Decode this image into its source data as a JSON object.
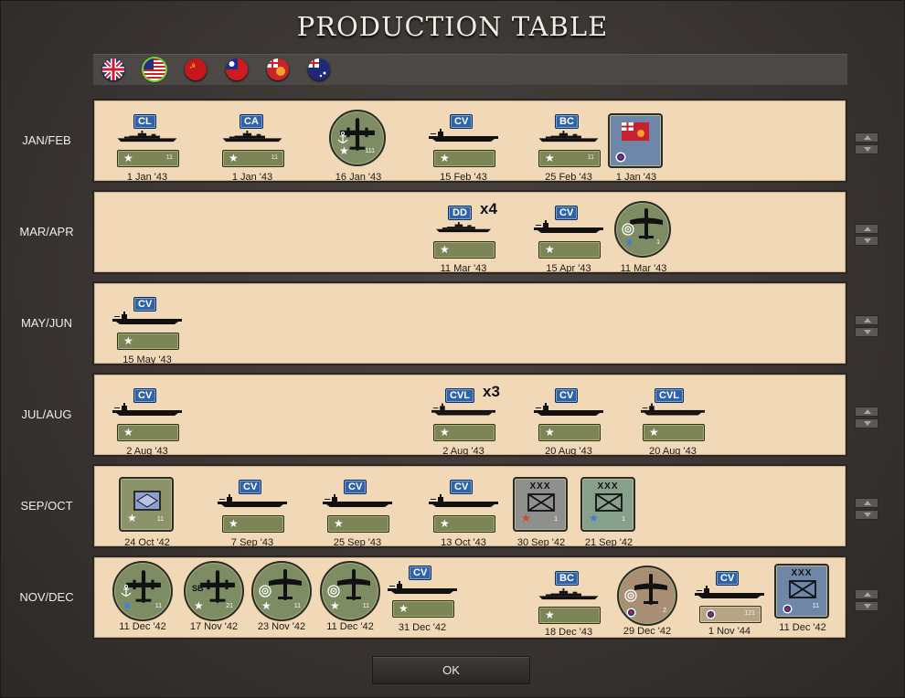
{
  "title": "PRODUCTION TABLE",
  "flags": [
    {
      "name": "uk-flag",
      "selected": false
    },
    {
      "name": "usa-flag",
      "selected": true
    },
    {
      "name": "ussr-flag",
      "selected": false
    },
    {
      "name": "china-flag",
      "selected": false
    },
    {
      "name": "india-flag",
      "selected": false
    },
    {
      "name": "australia-flag",
      "selected": false
    }
  ],
  "rows": [
    {
      "label": "JAN/FEB"
    },
    {
      "label": "MAR/APR"
    },
    {
      "label": "MAY/JUN"
    },
    {
      "label": "JUL/AUG"
    },
    {
      "label": "SEP/OCT"
    },
    {
      "label": "NOV/DEC"
    }
  ],
  "units": {
    "jf1": {
      "badge": "CL",
      "pips": "11",
      "date": "1 Jan '43"
    },
    "jf2": {
      "badge": "CA",
      "pips": "11",
      "date": "1 Jan '43"
    },
    "jf3": {
      "pips": "111",
      "date": "16 Jan '43"
    },
    "jf4": {
      "badge": "CV",
      "date": "15 Feb '43"
    },
    "jf5": {
      "badge": "BC",
      "pips": "11",
      "date": "25 Feb '43"
    },
    "jf6": {
      "date": "1 Jan '43"
    },
    "ma1": {
      "badge": "DD",
      "mult": "x4",
      "date": "11 Mar '43"
    },
    "ma2": {
      "badge": "CV",
      "date": "15 Apr '43"
    },
    "ma3": {
      "pips": "1",
      "date": "11 Mar '43"
    },
    "mj1": {
      "badge": "CV",
      "date": "15 May '43"
    },
    "ja1": {
      "badge": "CV",
      "date": "2 Aug '43"
    },
    "ja2": {
      "badge": "CVL",
      "mult": "x3",
      "date": "2 Aug '43"
    },
    "ja3": {
      "badge": "CV",
      "date": "20 Aug '43"
    },
    "ja4": {
      "badge": "CVL",
      "date": "20 Aug '43"
    },
    "so1": {
      "pips": "11",
      "date": "24 Oct '42"
    },
    "so2": {
      "badge": "CV",
      "date": "7 Sep '43"
    },
    "so3": {
      "badge": "CV",
      "date": "25 Sep '43"
    },
    "so4": {
      "badge": "CV",
      "date": "13 Oct '43"
    },
    "so5": {
      "xxx": "XXX",
      "pips": "1",
      "date": "30 Sep '42"
    },
    "so6": {
      "xxx": "XXX",
      "pips": "1",
      "date": "21 Sep '42"
    },
    "nd1": {
      "pips": "11",
      "date": "11 Dec '42"
    },
    "nd2": {
      "letters": "SB",
      "pips": "21",
      "date": "17 Nov '42"
    },
    "nd3": {
      "pips": "11",
      "date": "23 Nov '42"
    },
    "nd4": {
      "pips": "11",
      "date": "11 Dec '42"
    },
    "nd5": {
      "badge": "CV",
      "date": "31 Dec '42"
    },
    "nd6": {
      "badge": "BC",
      "date": "18 Dec '43"
    },
    "nd7": {
      "pips": "2",
      "date": "29 Dec '42"
    },
    "nd8": {
      "badge": "CV",
      "pips": "121",
      "date": "1 Nov '44"
    },
    "nd9": {
      "xxx": "XXX",
      "pips": "11",
      "date": "11 Dec '42"
    }
  },
  "ok_label": "OK"
}
